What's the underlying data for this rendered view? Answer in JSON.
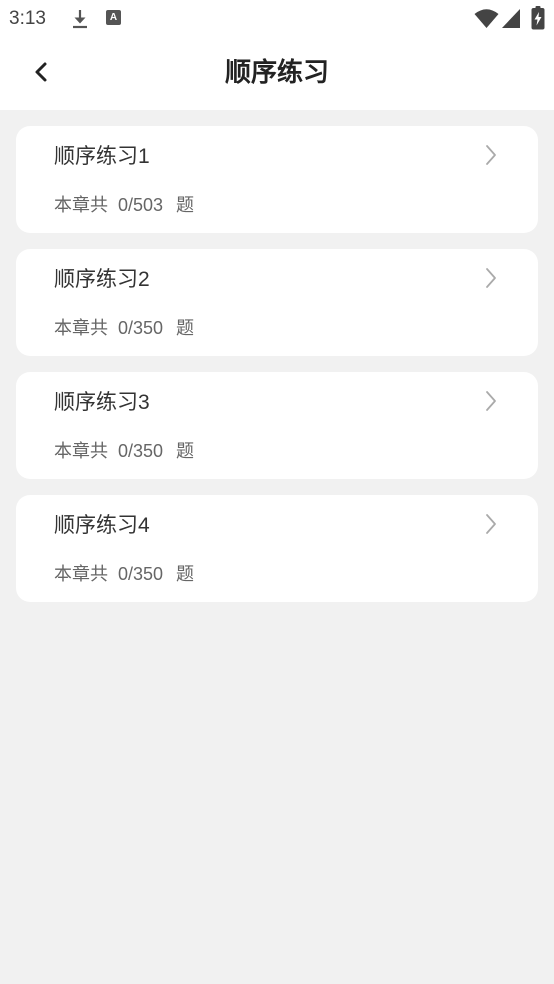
{
  "status_bar": {
    "time": "3:13",
    "notification_icons": [
      "download-icon",
      "app-a-icon"
    ],
    "app_icon_letter": "A",
    "system_icons": [
      "wifi-icon",
      "cellular-signal-icon",
      "battery-charging-icon"
    ]
  },
  "header": {
    "back_icon": "chevron-left-icon",
    "title": "顺序练习"
  },
  "practice_list": [
    {
      "title": "顺序练习1",
      "count_prefix": "本章共",
      "progress": "0/503",
      "count_suffix": "题",
      "icon": "chevron-right-icon"
    },
    {
      "title": "顺序练习2",
      "count_prefix": "本章共",
      "progress": "0/350",
      "count_suffix": "题",
      "icon": "chevron-right-icon"
    },
    {
      "title": "顺序练习3",
      "count_prefix": "本章共",
      "progress": "0/350",
      "count_suffix": "题",
      "icon": "chevron-right-icon"
    },
    {
      "title": "顺序练习4",
      "count_prefix": "本章共",
      "progress": "0/350",
      "count_suffix": "题",
      "icon": "chevron-right-icon"
    }
  ],
  "colors": {
    "page_background": "#f1f1f1",
    "surface": "#ffffff",
    "title_text": "#222222",
    "secondary_text": "#666666",
    "chevron": "#aaaaaa"
  }
}
